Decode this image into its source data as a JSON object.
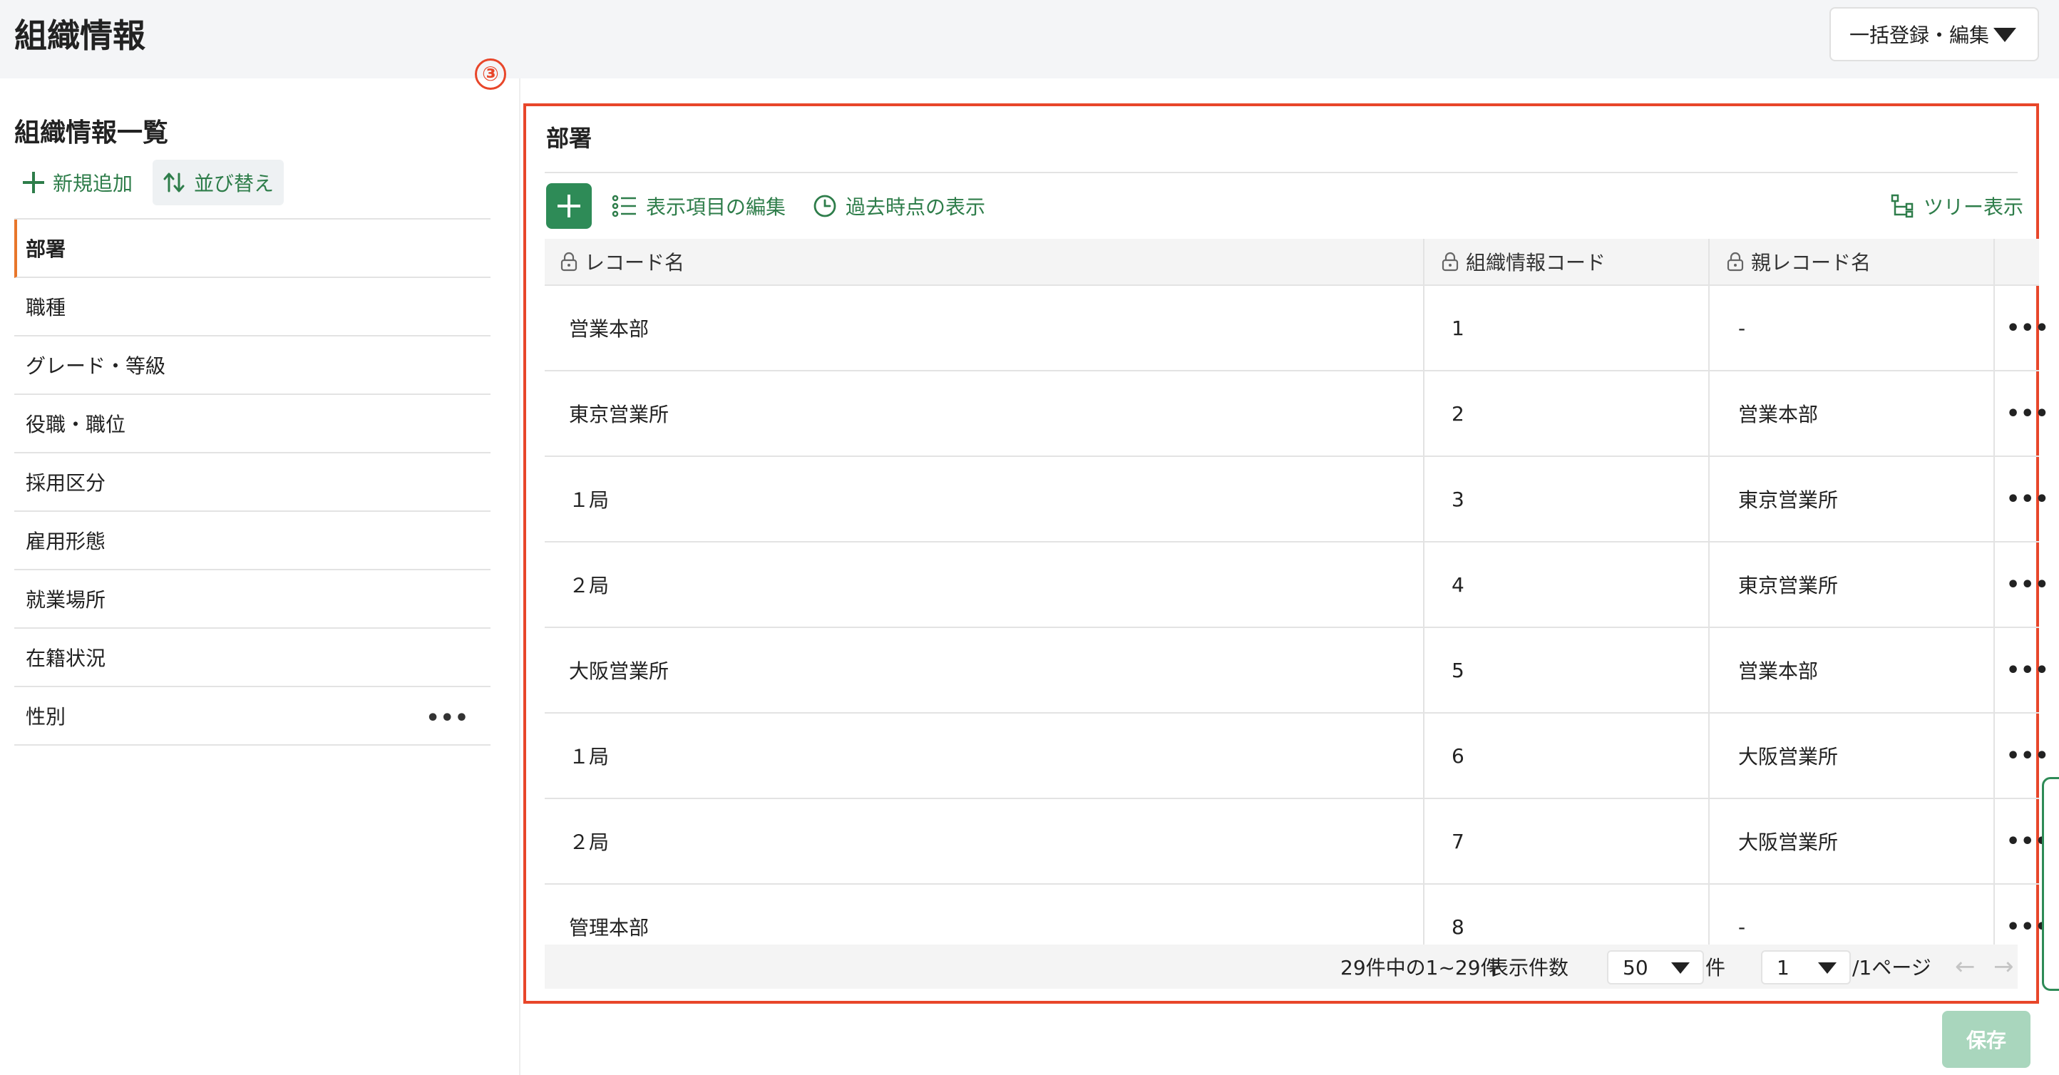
{
  "header": {
    "title": "組織情報",
    "bulk_button": "一括登録・編集"
  },
  "marker": "③",
  "sidebar": {
    "title": "組織情報一覧",
    "add_label": "新規追加",
    "sort_label": "並び替え",
    "items": [
      {
        "label": "部署"
      },
      {
        "label": "職種"
      },
      {
        "label": "グレード・等級"
      },
      {
        "label": "役職・職位"
      },
      {
        "label": "採用区分"
      },
      {
        "label": "雇用形態"
      },
      {
        "label": "就業場所"
      },
      {
        "label": "在籍状況"
      },
      {
        "label": "性別",
        "more": "•••"
      }
    ]
  },
  "panel": {
    "title": "部署",
    "edit_columns_label": "表示項目の編集",
    "past_view_label": "過去時点の表示",
    "tree_view_label": "ツリー表示",
    "columns": [
      "レコード名",
      "組織情報コード",
      "親レコード名"
    ],
    "row_menu": "•••",
    "rows": [
      {
        "name": "営業本部",
        "code": "1",
        "parent": "-"
      },
      {
        "name": "東京営業所",
        "code": "2",
        "parent": "営業本部"
      },
      {
        "name": "１局",
        "code": "3",
        "parent": "東京営業所"
      },
      {
        "name": "２局",
        "code": "4",
        "parent": "東京営業所"
      },
      {
        "name": "大阪営業所",
        "code": "5",
        "parent": "営業本部"
      },
      {
        "name": "１局",
        "code": "6",
        "parent": "大阪営業所"
      },
      {
        "name": "２局",
        "code": "7",
        "parent": "大阪営業所"
      },
      {
        "name": "管理本部",
        "code": "8",
        "parent": "-"
      }
    ],
    "footer": {
      "count_text": "29件中の1~29件",
      "per_page_label": "表示件数",
      "per_page_value": "50",
      "per_page_unit": "件",
      "page_value": "1",
      "page_total": "/1ページ",
      "prev": "←",
      "next": "→"
    }
  },
  "save_label": "保存",
  "colors": {
    "accent": "#2e8b57",
    "highlight": "#e8462a",
    "active_marker": "#e8762a"
  }
}
